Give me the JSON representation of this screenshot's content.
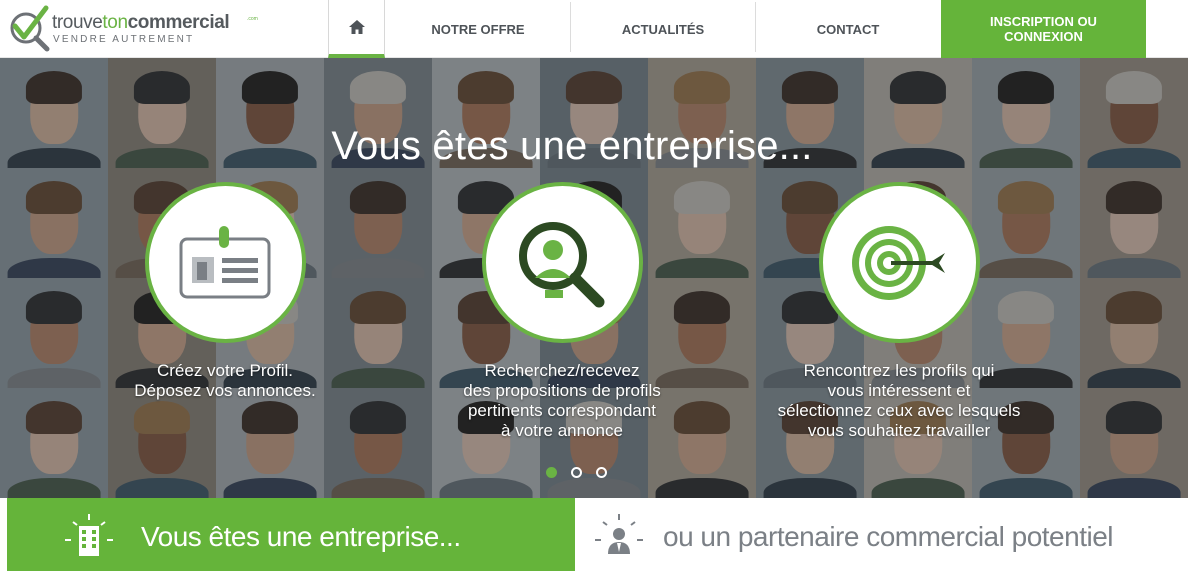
{
  "logo": {
    "part1": "trouve",
    "part2": "ton",
    "part3": "commercial",
    "dotcom": ".com",
    "tagline": "VENDRE AUTREMENT"
  },
  "nav": {
    "home_icon": "home-icon",
    "items": [
      {
        "label": "NOTRE OFFRE"
      },
      {
        "label": "ACTUALITÉS"
      },
      {
        "label": "CONTACT"
      }
    ],
    "cta_line1": "INSCRIPTION OU",
    "cta_line2": "CONNEXION"
  },
  "hero": {
    "title": "Vous êtes une entreprise...",
    "features": [
      {
        "icon": "id-card-icon",
        "lines": [
          "Créez votre Profil.",
          "Déposez vos annonces."
        ]
      },
      {
        "icon": "magnifier-person-icon",
        "lines": [
          "Recherchez/recevez",
          "des propositions de profils",
          "pertinents correspondant",
          "à votre annonce"
        ]
      },
      {
        "icon": "target-icon",
        "lines": [
          "Rencontrez les profils qui",
          "vous intéressent et",
          "sélectionnez ceux avec lesquels",
          "vous souhaitez travailler"
        ]
      }
    ],
    "carousel": {
      "active_index": 0,
      "count": 3
    }
  },
  "tabs": {
    "enterprise": {
      "label": "Vous êtes une entreprise...",
      "icon": "building-icon"
    },
    "partner": {
      "label": "ou un partenaire commercial potentiel",
      "icon": "person-icon"
    }
  },
  "colors": {
    "brand_green": "#65b43a",
    "dark_grey": "#4e5358"
  }
}
